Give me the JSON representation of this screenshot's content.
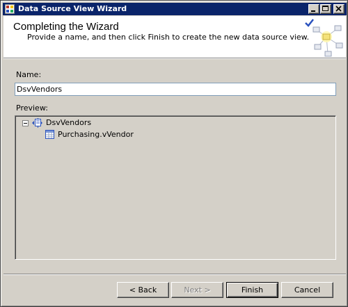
{
  "window": {
    "title": "Data Source View Wizard"
  },
  "header": {
    "title": "Completing the Wizard",
    "subtitle": "Provide a name, and then click Finish to create the new data source view."
  },
  "form": {
    "name_label": "Name:",
    "name_value": "DsvVendors",
    "preview_label": "Preview:"
  },
  "tree": {
    "root_label": "DsvVendors",
    "children": [
      {
        "label": "Purchasing.vVendor"
      }
    ]
  },
  "buttons": {
    "back": "< Back",
    "next": "Next >",
    "finish": "Finish",
    "cancel": "Cancel"
  },
  "colors": {
    "titlebar": "#0a246a",
    "face": "#d4d0c8",
    "accent_blue": "#2a52be"
  },
  "icons": {
    "app": "wizard-app-icon",
    "minimize": "minimize-icon",
    "maximize": "maximize-icon",
    "close": "close-icon",
    "header_graphic": "data-source-view-graphic",
    "dsv": "data-source-view-icon",
    "table": "table-icon",
    "collapse": "collapse-minus-icon"
  },
  "state": {
    "next_enabled": false,
    "root_expanded": true
  }
}
